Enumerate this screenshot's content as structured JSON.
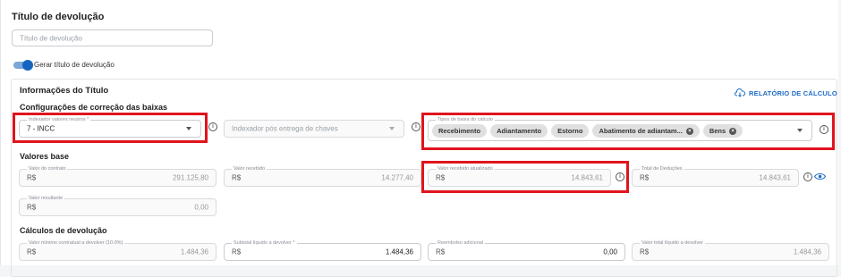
{
  "header": {
    "title": "Título de devolução"
  },
  "titulo_input": {
    "placeholder": "Título de devolução"
  },
  "toggle": {
    "label": "Gerar título de devolução",
    "on": true
  },
  "info_section": {
    "title": "Informações do Título",
    "report_link": "RELATÓRIO DE CÁLCULO"
  },
  "correcao": {
    "title": "Configurações de correção das baixas",
    "indexador": {
      "label": "Indexador valores neutros *",
      "value": "7 - INCC"
    },
    "indexador_pos": {
      "placeholder": "Indexador pós entrega de chaves"
    },
    "tipos": {
      "label": "Tipos de baixa do cálculo",
      "chips": [
        "Recebimento",
        "Adiantamento",
        "Estorno",
        "Abatimento de adiantam...",
        "Bens"
      ],
      "removable": [
        false,
        false,
        false,
        true,
        true
      ]
    }
  },
  "valores_base": {
    "title": "Valores base",
    "currency": "R$",
    "contrato": {
      "label": "Valor do contrato",
      "value": "291.125,80"
    },
    "recebido": {
      "label": "Valor recebido",
      "value": "14.277,40"
    },
    "recebido_atualizado": {
      "label": "Valor recebido atualizado",
      "value": "14.843,61"
    },
    "deducoes": {
      "label": "Total de Deduções",
      "value": "14.843,61"
    },
    "resultante": {
      "label": "Valor resultante",
      "value": "0,00"
    }
  },
  "calculos": {
    "title": "Cálculos de devolução",
    "minimo": {
      "label": "Valor mínimo contratual a devolver (10.0%)",
      "value": "1.484,36"
    },
    "subtotal": {
      "label": "Subtotal líquido a devolver *",
      "value": "1.484,36"
    },
    "reembolso": {
      "label": "Reembolso adicional",
      "value": "0,00"
    },
    "total": {
      "label": "Valor total líquido a devolver",
      "value": "1.484,36"
    }
  },
  "colors": {
    "accent": "#1565c0",
    "highlight": "#e0141e"
  }
}
